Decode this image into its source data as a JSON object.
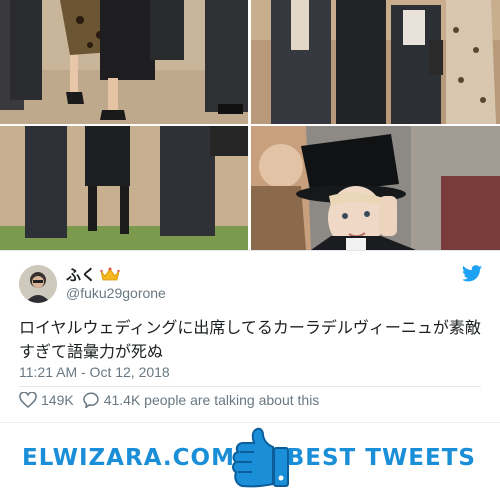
{
  "photos": {
    "top_left": "wedding-guests-legs-photo",
    "top_right": "wedding-guests-walking-photo",
    "bottom_left": "wedding-guests-stairs-photo",
    "bottom_right": "woman-in-top-hat-photo"
  },
  "tweet": {
    "display_name": "ふく",
    "name_emoji": "crown-icon",
    "handle": "@fuku29gorone",
    "text": "ロイヤルウェディングに出席してるカーラデルヴィーニュが素敵すぎて語彙力が死ぬ",
    "timestamp": "11:21 AM - Oct 12, 2018",
    "likes": "149K",
    "replies_text": "41.4K people are talking about this",
    "brand_icon": "twitter-bird-icon"
  },
  "banner": {
    "left_text": "ELWIZARA.COM",
    "right_text": "BEST TWEETS",
    "center_icon": "thumbs-up-icon"
  },
  "colors": {
    "brand_blue": "#1a8fd8",
    "twitter_blue": "#1da1f2",
    "muted_text": "#697882"
  }
}
